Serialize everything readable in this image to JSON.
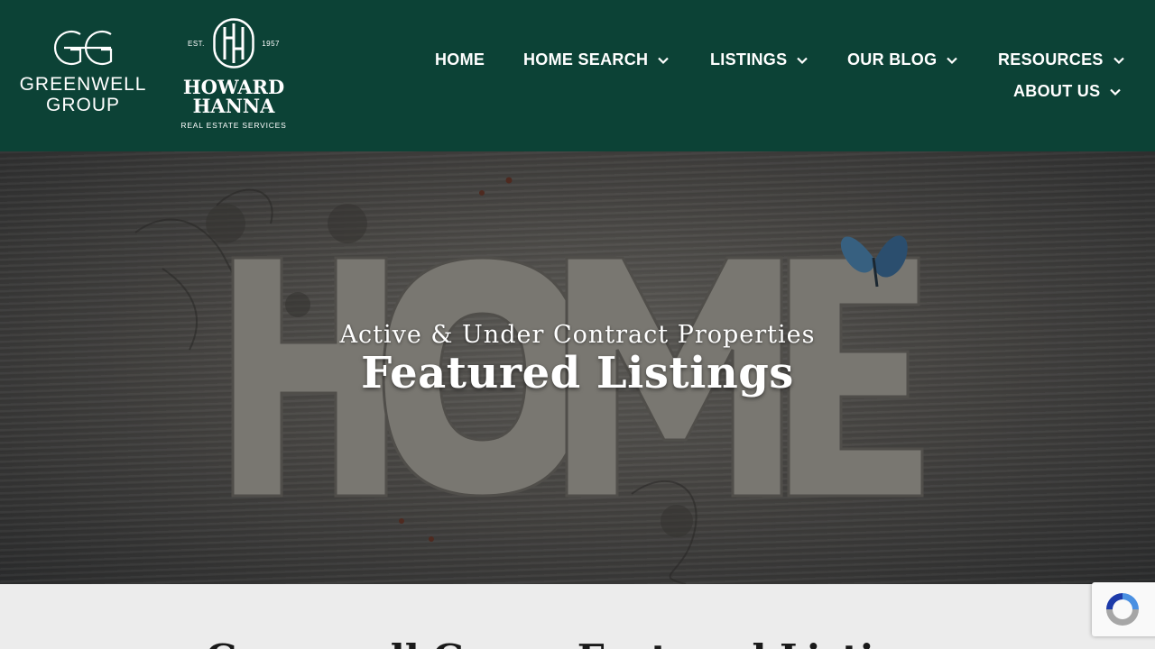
{
  "brand": {
    "greenwell_line1": "GREENWELL",
    "greenwell_line2": "GROUP",
    "hh_est": "EST.",
    "hh_year": "1957",
    "hh_name_line1": "HOWARD",
    "hh_name_line2": "HANNA",
    "hh_subtitle": "REAL ESTATE SERVICES"
  },
  "nav": {
    "home": "HOME",
    "home_search": "HOME SEARCH",
    "listings": "LISTINGS",
    "our_blog": "OUR BLOG",
    "resources": "RESOURCES",
    "about_us": "ABOUT US"
  },
  "hero": {
    "subtitle": "Active & Under Contract Properties",
    "title": "Featured Listings"
  },
  "section": {
    "heading": "Greenwell Group Featured Listings"
  },
  "colors": {
    "header_bg": "#0c4236",
    "nav_text": "#ffffff",
    "section_bg": "#ececec"
  },
  "icons": {
    "chevron": "chevron-down-icon",
    "recaptcha": "recaptcha-icon"
  }
}
